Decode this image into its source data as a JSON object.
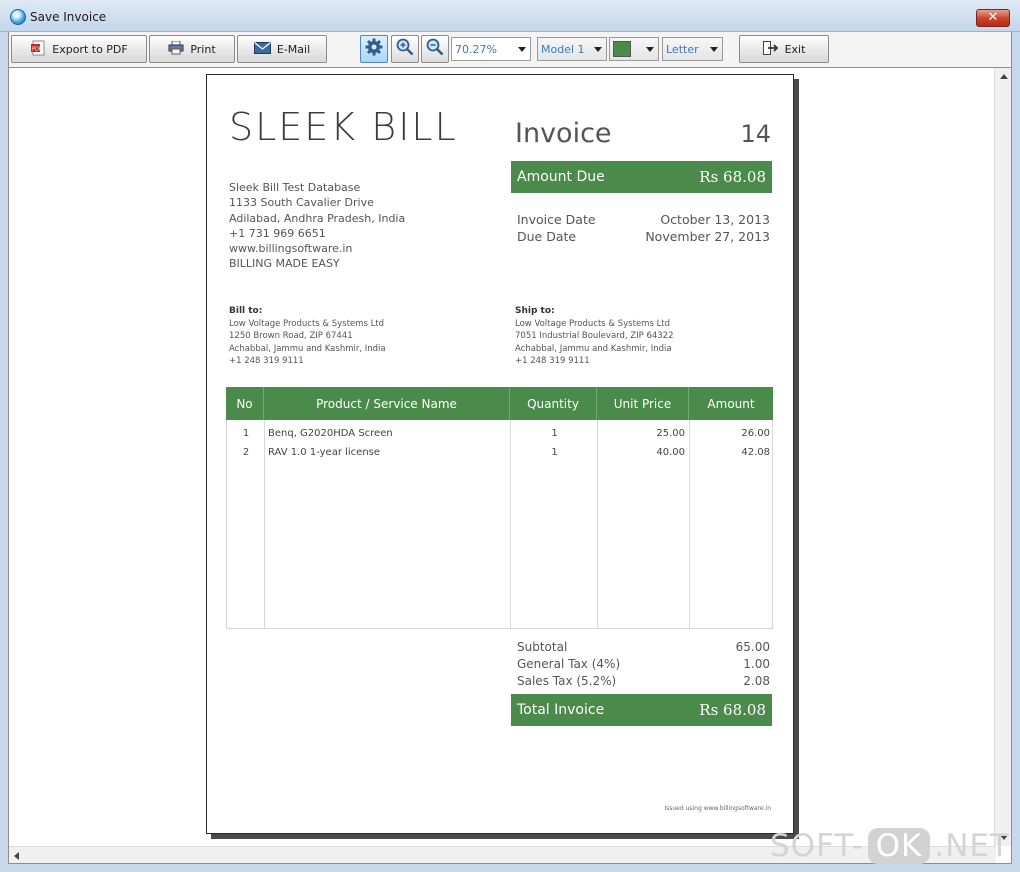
{
  "window": {
    "title": "Save Invoice",
    "close_label": "✕"
  },
  "toolbar": {
    "export_label": "Export to PDF",
    "print_label": "Print",
    "email_label": "E-Mail",
    "zoom_value": "70.27%",
    "model_value": "Model 1",
    "color_value": "#4a8a4a",
    "paper_value": "Letter",
    "exit_label": "Exit"
  },
  "invoice": {
    "logo": "SLEEK BILL",
    "title": "Invoice",
    "number": "14",
    "amount_due_label": "Amount Due",
    "amount_due_value": "Rs 68.08",
    "invoice_date_label": "Invoice Date",
    "invoice_date_value": "October 13, 2013",
    "due_date_label": "Due Date",
    "due_date_value": "November 27, 2013",
    "company": [
      "Sleek Bill Test Database",
      "1133 South Cavalier Drive",
      "Adilabad, Andhra Pradesh, India",
      "+1 731 969 6651",
      "www.billingsoftware.in",
      "BILLING MADE EASY"
    ],
    "bill_to": {
      "header": "Bill to:",
      "lines": [
        "Low Voltage Products & Systems Ltd",
        "1250 Brown Road, ZIP 67441",
        "Achabbal, Jammu and Kashmir, India",
        "+1 248 319 9111"
      ]
    },
    "ship_to": {
      "header": "Ship to:",
      "lines": [
        "Low Voltage Products & Systems Ltd",
        "7051 Industrial Boulevard, ZIP 64322",
        "Achabbal, Jammu and Kashmir, India",
        "+1 248 319 9111"
      ]
    },
    "columns": [
      "No",
      "Product / Service Name",
      "Quantity",
      "Unit Price",
      "Amount"
    ],
    "rows": [
      {
        "no": "1",
        "name": "Benq, G2020HDA Screen",
        "qty": "1",
        "price": "25.00",
        "amount": "26.00"
      },
      {
        "no": "2",
        "name": "RAV 1.0 1-year license",
        "qty": "1",
        "price": "40.00",
        "amount": "42.08"
      }
    ],
    "subtotal_label": "Subtotal",
    "subtotal_value": "65.00",
    "general_tax_label": "General Tax (4%)",
    "general_tax_value": "1.00",
    "sales_tax_label": "Sales Tax (5.2%)",
    "sales_tax_value": "2.08",
    "total_label": "Total Invoice",
    "total_value": "Rs 68.08",
    "footer_note": "Issued using www.billingsoftware.in"
  },
  "watermark": {
    "part1": "SOFT-",
    "part2": "OK",
    "part3": ".NET"
  }
}
